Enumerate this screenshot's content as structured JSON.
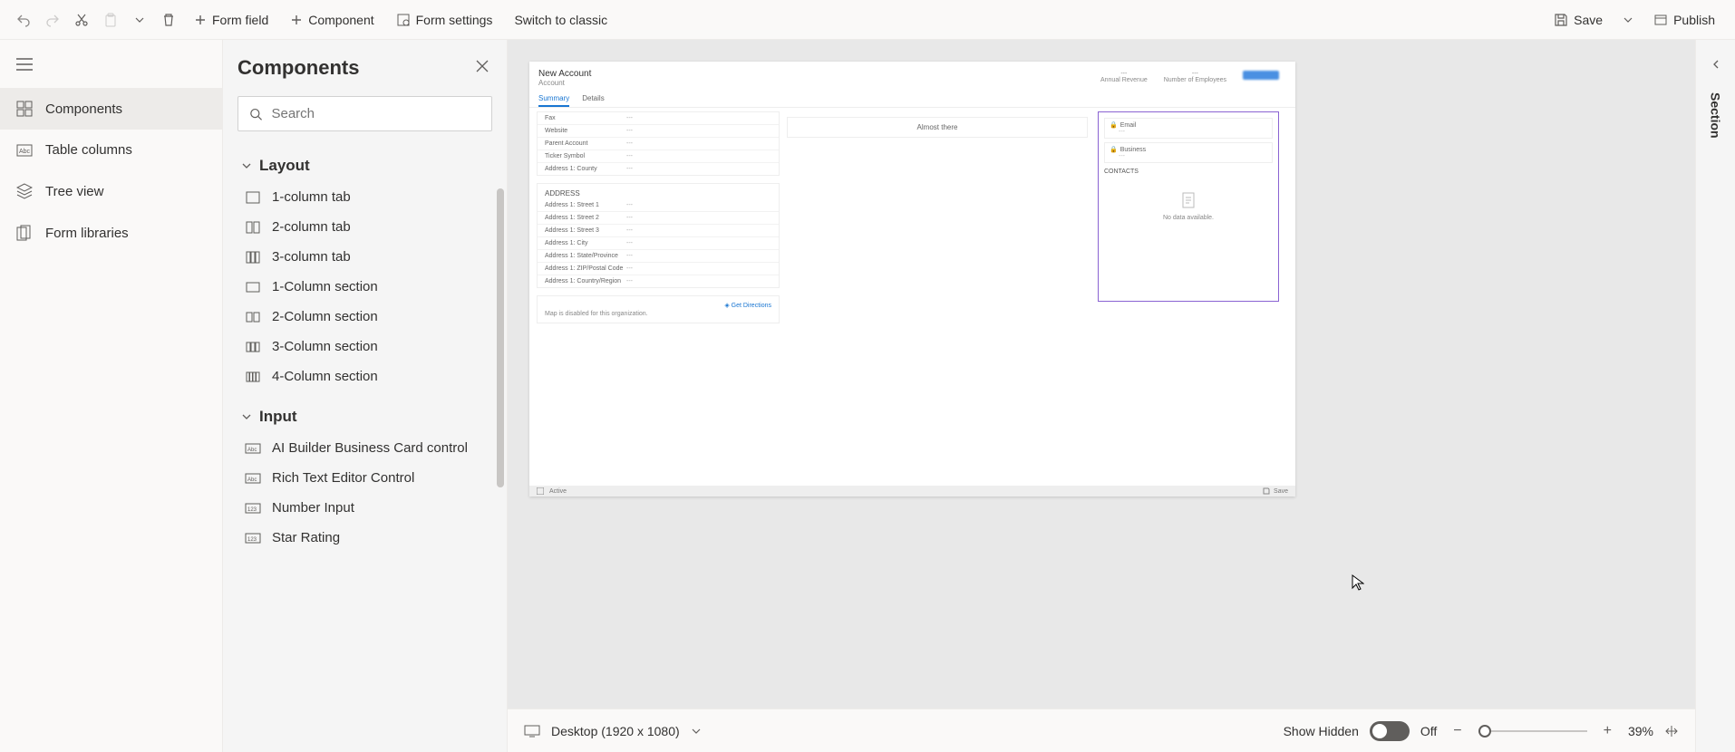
{
  "toolbar": {
    "form_field": "Form field",
    "component": "Component",
    "form_settings": "Form settings",
    "switch_classic": "Switch to classic",
    "save": "Save",
    "publish": "Publish"
  },
  "left_rail": {
    "items": [
      {
        "label": "Components"
      },
      {
        "label": "Table columns"
      },
      {
        "label": "Tree view"
      },
      {
        "label": "Form libraries"
      }
    ]
  },
  "components_panel": {
    "title": "Components",
    "search_placeholder": "Search",
    "groups": {
      "layout": {
        "title": "Layout",
        "items": [
          "1-column tab",
          "2-column tab",
          "3-column tab",
          "1-Column section",
          "2-Column section",
          "3-Column section",
          "4-Column section"
        ]
      },
      "input": {
        "title": "Input",
        "items": [
          "AI Builder Business Card control",
          "Rich Text Editor Control",
          "Number Input",
          "Star Rating"
        ]
      }
    }
  },
  "preview": {
    "title": "New Account",
    "subtitle": "Account",
    "header_right": [
      "Annual Revenue",
      "Number of Employees"
    ],
    "tabs": [
      "Summary",
      "Details"
    ],
    "col2_banner": "Almost there",
    "fields_top": [
      {
        "label": "Fax",
        "value": "---"
      },
      {
        "label": "Website",
        "value": "---"
      },
      {
        "label": "Parent Account",
        "value": "---"
      },
      {
        "label": "Ticker Symbol",
        "value": "---"
      },
      {
        "label": "Address 1: County",
        "value": "---"
      }
    ],
    "address_section": "ADDRESS",
    "address_fields": [
      {
        "label": "Address 1: Street 1",
        "value": "---"
      },
      {
        "label": "Address 1: Street 2",
        "value": "---"
      },
      {
        "label": "Address 1: Street 3",
        "value": "---"
      },
      {
        "label": "Address 1: City",
        "value": "---"
      },
      {
        "label": "Address 1: State/Province",
        "value": "---"
      },
      {
        "label": "Address 1: ZIP/Postal Code",
        "value": "---"
      },
      {
        "label": "Address 1: Country/Region",
        "value": "---"
      }
    ],
    "map": {
      "directions": "Get Directions",
      "disabled_msg": "Map is disabled for this organization."
    },
    "side": {
      "email": "Email",
      "business": "Business",
      "placeholder": "---",
      "contacts_header": "CONTACTS",
      "no_data": "No data available."
    },
    "status_left": "Active",
    "status_right": "Save"
  },
  "bottom": {
    "viewport": "Desktop (1920 x 1080)",
    "show_hidden": "Show Hidden",
    "toggle_state": "Off",
    "zoom": "39%"
  },
  "right_pane": {
    "label": "Section"
  }
}
